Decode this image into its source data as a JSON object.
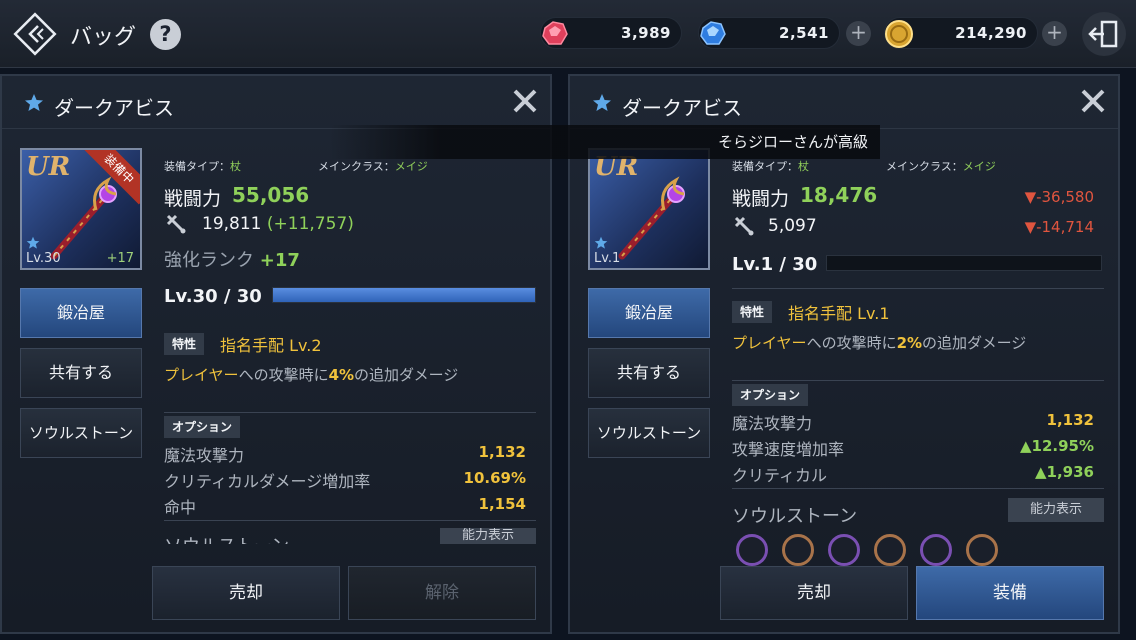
{
  "header": {
    "title": "バッグ",
    "help_label": "?",
    "currencies": [
      {
        "name": "ruby",
        "value": "3,989"
      },
      {
        "name": "sapphire",
        "value": "2,541"
      },
      {
        "name": "gold",
        "value": "214,290"
      }
    ],
    "plus_label": "+"
  },
  "chat_toast": "そらジローさんが高級",
  "left_panel": {
    "title": "ダークアビス",
    "item": {
      "rarity": "UR",
      "level": "Lv.30",
      "plus": "+17",
      "status_ribbon": "装備中"
    },
    "equip_type_label": "装備タイプ：",
    "equip_type_value": "杖",
    "main_class_label": "メインクラス：",
    "main_class_value": "メイジ",
    "combat_power_label": "戦闘力",
    "combat_power_value": "55,056",
    "attack_value": "19,811",
    "attack_bonus": "(+11,757)",
    "rank_label": "強化ランク",
    "rank_value": "+17",
    "level_text": "Lv.30 / 30",
    "level_fill": 1.0,
    "trait_tag": "特性",
    "trait_name": "指名手配 Lv.2",
    "trait_desc_highlight": "プレイヤー",
    "trait_desc_mid": "への攻撃時に",
    "trait_desc_pct": "4%",
    "trait_desc_tail": "の追加ダメージ",
    "options_tag": "オプション",
    "options": [
      {
        "label": "魔法攻撃力",
        "value": "1,132"
      },
      {
        "label": "クリティカルダメージ増加率",
        "value": "10.69%"
      },
      {
        "label": "命中",
        "value": "1,154"
      }
    ],
    "soulstone_partial": "ソウルストーン",
    "ability_button": "能力表示",
    "side_buttons": [
      "鍛冶屋",
      "共有する",
      "ソウルストーン"
    ],
    "footer_buttons": [
      "売却",
      "解除"
    ]
  },
  "right_panel": {
    "title": "ダークアビス",
    "item": {
      "rarity": "UR",
      "level": "Lv.1"
    },
    "equip_type_label": "装備タイプ：",
    "equip_type_value": "杖",
    "main_class_label": "メインクラス：",
    "main_class_value": "メイジ",
    "combat_power_label": "戦闘力",
    "combat_power_value": "18,476",
    "combat_power_diff": "▼-36,580",
    "attack_value": "5,097",
    "attack_diff": "▼-14,714",
    "level_text": "Lv.1 / 30",
    "level_fill": 0.0,
    "trait_tag": "特性",
    "trait_name": "指名手配 Lv.1",
    "trait_desc_highlight": "プレイヤー",
    "trait_desc_mid": "への攻撃時に",
    "trait_desc_pct": "2%",
    "trait_desc_tail": "の追加ダメージ",
    "options_tag": "オプション",
    "options": [
      {
        "label": "魔法攻撃力",
        "value": "1,132"
      },
      {
        "label": "攻撃速度増加率",
        "value": "▲12.95%"
      },
      {
        "label": "クリティカル",
        "value": "▲1,936"
      }
    ],
    "soulstone_title": "ソウルストーン",
    "ability_button": "能力表示",
    "side_buttons": [
      "鍛冶屋",
      "共有する",
      "ソウルストーン"
    ],
    "footer_buttons": [
      "売却",
      "装備"
    ]
  },
  "colors": {
    "accent_green": "#8fd15a",
    "accent_yellow": "#f0c23c",
    "accent_red": "#e0553f",
    "button_blue": "#3e6aa8"
  }
}
